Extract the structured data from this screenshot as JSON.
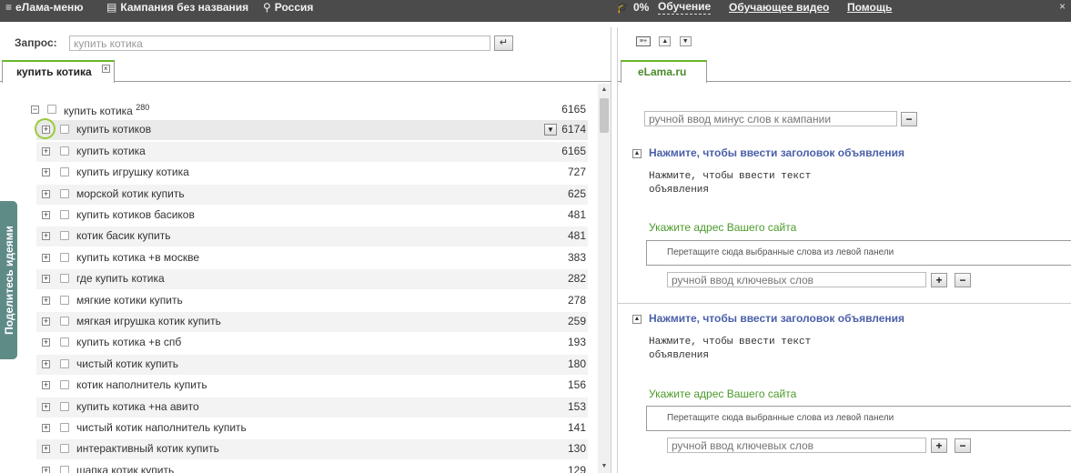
{
  "topbar": {
    "menu": "eЛама-меню",
    "campaign": "Кампания без названия",
    "region": "Россия",
    "training_pct": "0%",
    "training": "Обучение",
    "video": "Обучающее видео",
    "help": "Помощь"
  },
  "query": {
    "label": "Запрос:",
    "value": "купить котика",
    "go_icon": "enter-icon"
  },
  "left_tab": {
    "label": "купить котика"
  },
  "tree": {
    "root": {
      "label": "купить котика",
      "sup": "280",
      "count": "6165"
    },
    "rows": [
      {
        "label": "купить котиков",
        "count": "6174"
      },
      {
        "label": "купить котика",
        "count": "6165"
      },
      {
        "label": "купить игрушку котика",
        "count": "727"
      },
      {
        "label": "морской котик купить",
        "count": "625"
      },
      {
        "label": "купить котиков басиков",
        "count": "481"
      },
      {
        "label": "котик басик купить",
        "count": "481"
      },
      {
        "label": "купить котика +в москве",
        "count": "383"
      },
      {
        "label": "где купить котика",
        "count": "282"
      },
      {
        "label": "мягкие котики купить",
        "count": "278"
      },
      {
        "label": "мягкая игрушка котик купить",
        "count": "259"
      },
      {
        "label": "купить котика +в спб",
        "count": "193"
      },
      {
        "label": "чистый котик купить",
        "count": "180"
      },
      {
        "label": "котик наполнитель купить",
        "count": "156"
      },
      {
        "label": "купить котика +на авито",
        "count": "153"
      },
      {
        "label": "чистый котик наполнитель купить",
        "count": "141"
      },
      {
        "label": "интерактивный котик купить",
        "count": "130"
      },
      {
        "label": "шапка котик купить",
        "count": "129"
      }
    ]
  },
  "share": {
    "label": "Поделитесь идеями"
  },
  "right_tab": {
    "label": "eLama.ru"
  },
  "minus_words": {
    "placeholder": "ручной ввод минус слов к кампании"
  },
  "ads": [
    {
      "headline": "Нажмите, чтобы ввести заголовок объявления",
      "text": "Нажмите, чтобы ввести текст\nобъявления",
      "url": "Укажите адрес Вашего сайта",
      "drop": "Перетащите сюда выбранные слова из левой панели",
      "kw_placeholder": "ручной ввод ключевых слов"
    },
    {
      "headline": "Нажмите, чтобы ввести заголовок объявления",
      "text": "Нажмите, чтобы ввести текст\nобъявления",
      "url": "Укажите адрес Вашего сайта",
      "drop": "Перетащите сюда выбранные слова из левой панели",
      "kw_placeholder": "ручной ввод ключевых слов"
    }
  ],
  "colors": {
    "accent_green": "#68b52e",
    "headline_blue": "#4a60a8",
    "topbar": "#4b4b4b"
  }
}
